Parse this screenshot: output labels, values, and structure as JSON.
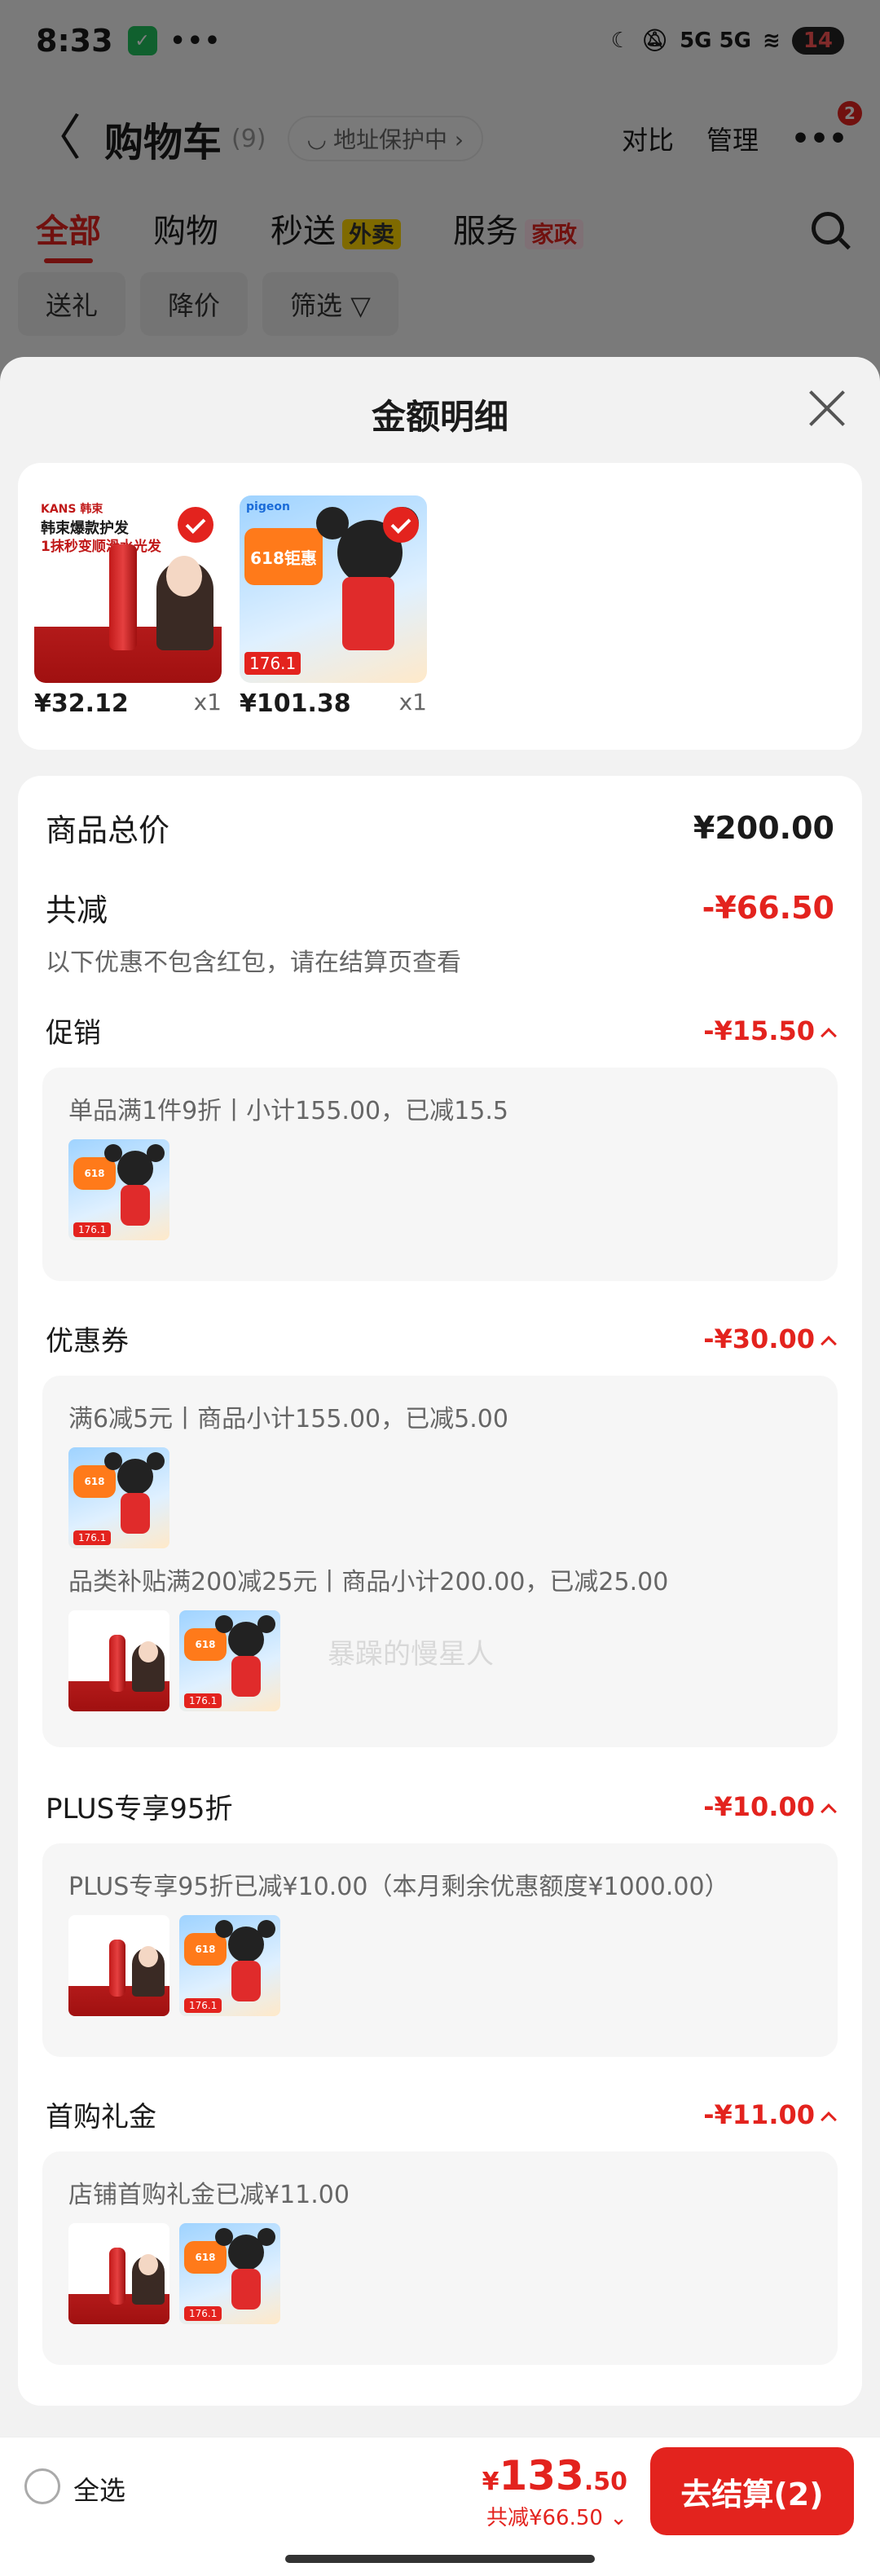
{
  "status_bar": {
    "time": "8:33",
    "app_icon": "wechat-icon",
    "more_dots": "•••",
    "signals": "5G 5G",
    "battery": "14"
  },
  "cart_header": {
    "back": "〈",
    "title": "购物车",
    "count": "(9)",
    "address_protection": "地址保护中 ›",
    "compare": "对比",
    "manage": "管理",
    "more_badge": "2"
  },
  "tabs": [
    {
      "label": "全部"
    },
    {
      "label": "购物"
    },
    {
      "label": "秒送",
      "tag": "外卖"
    },
    {
      "label": "服务",
      "tag": "家政"
    }
  ],
  "chips": [
    "送礼",
    "降价",
    "筛选 ▽"
  ],
  "sheet": {
    "title": "金额明细",
    "goods": [
      {
        "price": "¥32.12",
        "qty": "x1",
        "thumb_brand": "KANS 韩束",
        "thumb_line1": "韩束爆款护发",
        "thumb_line2": "1抹秒变顺滑水光发"
      },
      {
        "price": "¥101.38",
        "qty": "x1",
        "thumb_brand": "pigeon",
        "thumb_promo": "618钜惠",
        "thumb_price": "176.1"
      }
    ],
    "summary": {
      "total_label": "商品总价",
      "total_value": "¥200.00",
      "discount_label": "共减",
      "discount_value": "-¥66.50",
      "note": "以下优惠不包含红包，请在结算页查看"
    },
    "sections": [
      {
        "label": "促销",
        "value": "-¥15.50",
        "lines": [
          "单品满1件9折丨小计155.00，已减15.5"
        ]
      },
      {
        "label": "优惠券",
        "value": "-¥30.00",
        "lines": [
          "满6减5元丨商品小计155.00，已减5.00",
          "品类补贴满200减25元丨商品小计200.00，已减25.00"
        ]
      },
      {
        "label": "PLUS专享95折",
        "value": "-¥10.00",
        "lines": [
          "PLUS专享95折已减¥10.00（本月剩余优惠额度¥1000.00）"
        ]
      },
      {
        "label": "首购礼金",
        "value": "-¥11.00",
        "lines": [
          "店铺首购礼金已减¥11.00"
        ]
      }
    ],
    "watermark": "暴躁的慢星人"
  },
  "bottom_bar": {
    "select_all": "全选",
    "yen": "¥",
    "amount_int": "133",
    "amount_dec": ".50",
    "saved": "共减¥66.50 ⌄",
    "checkout": "去结算(2)"
  },
  "colors": {
    "accent": "#e3231e",
    "sheet_bg": "#f2f2f2"
  }
}
